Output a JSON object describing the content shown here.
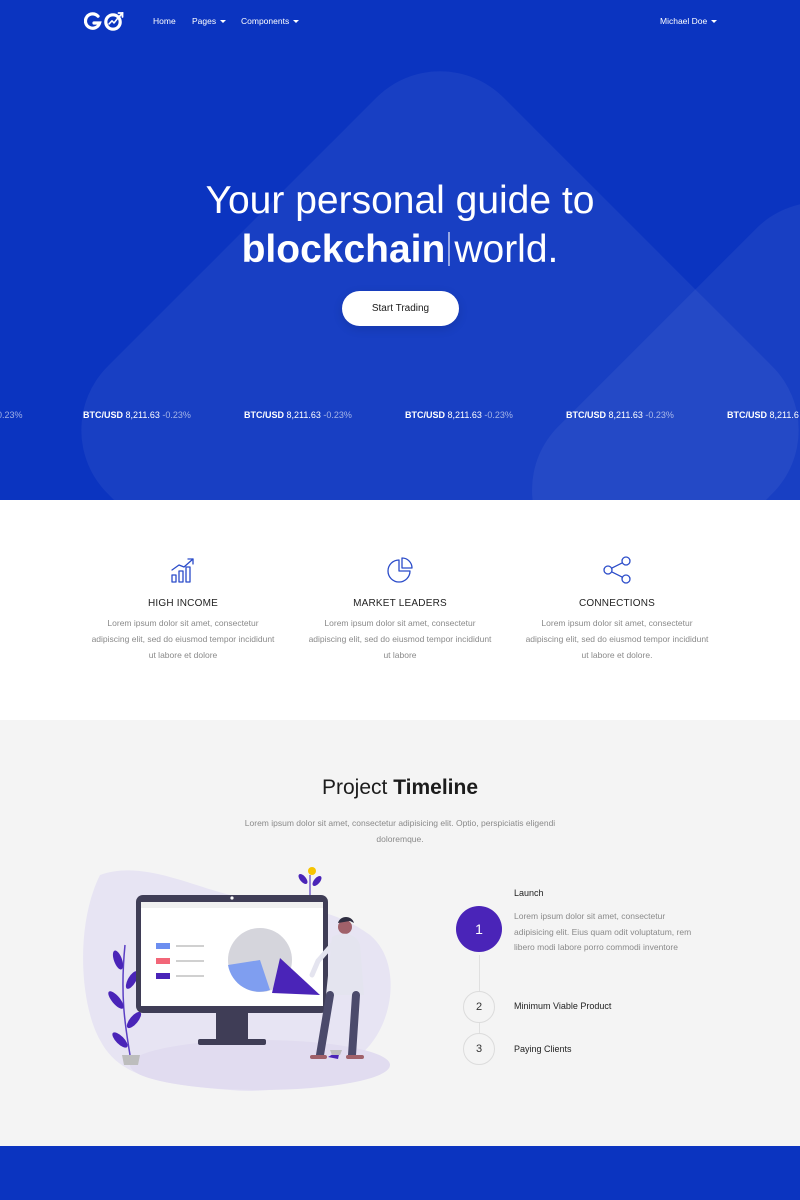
{
  "nav": {
    "logo_text": "GO",
    "links": [
      {
        "label": "Home",
        "dropdown": false
      },
      {
        "label": "Pages",
        "dropdown": true
      },
      {
        "label": "Components",
        "dropdown": true
      }
    ],
    "user": "Michael Doe"
  },
  "hero": {
    "line1": "Your personal guide to",
    "word": "blockchain",
    "line2_rest": "world.",
    "cta_label": "Start Trading",
    "ticker": [
      {
        "pair": "",
        "price": "",
        "change": "-0.23%"
      },
      {
        "pair": "BTC/USD",
        "price": "8,211.63",
        "change": "-0.23%"
      },
      {
        "pair": "BTC/USD",
        "price": "8,211.63",
        "change": "-0.23%"
      },
      {
        "pair": "BTC/USD",
        "price": "8,211.63",
        "change": "-0.23%"
      },
      {
        "pair": "BTC/USD",
        "price": "8,211.63",
        "change": "-0.23%"
      },
      {
        "pair": "BTC/USD",
        "price": "8,211.6",
        "change": ""
      }
    ]
  },
  "features": [
    {
      "icon": "chart-growth-icon",
      "title": "HIGH INCOME",
      "text": "Lorem ipsum dolor sit amet, consectetur adipiscing elit, sed do eiusmod tempor incididunt ut labore et dolore"
    },
    {
      "icon": "pie-chart-icon",
      "title": "MARKET LEADERS",
      "text": "Lorem ipsum dolor sit amet, consectetur adipiscing elit, sed do eiusmod tempor incididunt ut labore"
    },
    {
      "icon": "share-nodes-icon",
      "title": "CONNECTIONS",
      "text": "Lorem ipsum dolor sit amet, consectetur adipiscing elit, sed do eiusmod tempor incididunt ut labore et dolore."
    }
  ],
  "timeline": {
    "title_light": "Project",
    "title_bold": "Timeline",
    "subtitle": "Lorem ipsum dolor sit amet, consectetur adipisicing elit. Optio, perspiciatis eligendi doloremque.",
    "steps": [
      {
        "num": "1",
        "label": "Launch",
        "desc": "Lorem ipsum dolor sit amet, consectetur adipisicing elit. Eius quam odit voluptatum, rem libero modi labore porro commodi inventore",
        "active": true
      },
      {
        "num": "2",
        "label": "Minimum Viable Product",
        "desc": "",
        "active": false
      },
      {
        "num": "3",
        "label": "Paying Clients",
        "desc": "",
        "active": false
      }
    ]
  },
  "colors": {
    "brand_blue": "#0b34c0",
    "accent_purple": "#4a24b8",
    "light_bg": "#f4f4f4",
    "muted_text": "#8a8a8a"
  }
}
